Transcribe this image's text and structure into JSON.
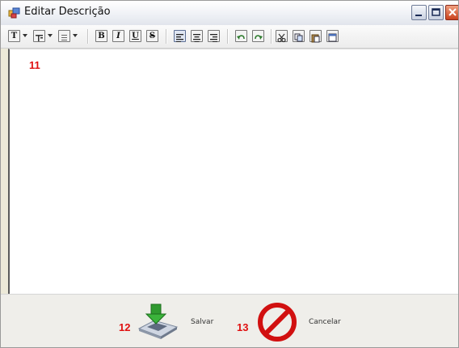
{
  "window": {
    "title": "Editar Descrição"
  },
  "toolbar": {
    "font_icon": "T",
    "bold": "B",
    "italic": "I",
    "underline": "U",
    "strike": "S"
  },
  "annotations": {
    "editor_number": "11",
    "save_number": "12",
    "cancel_number": "13"
  },
  "actions": {
    "save_label": "Salvar",
    "cancel_label": "Cancelar"
  },
  "colors": {
    "annotation": "#e01010",
    "cancel_icon": "#d11010",
    "save_arrow": "#2f9a2f"
  }
}
